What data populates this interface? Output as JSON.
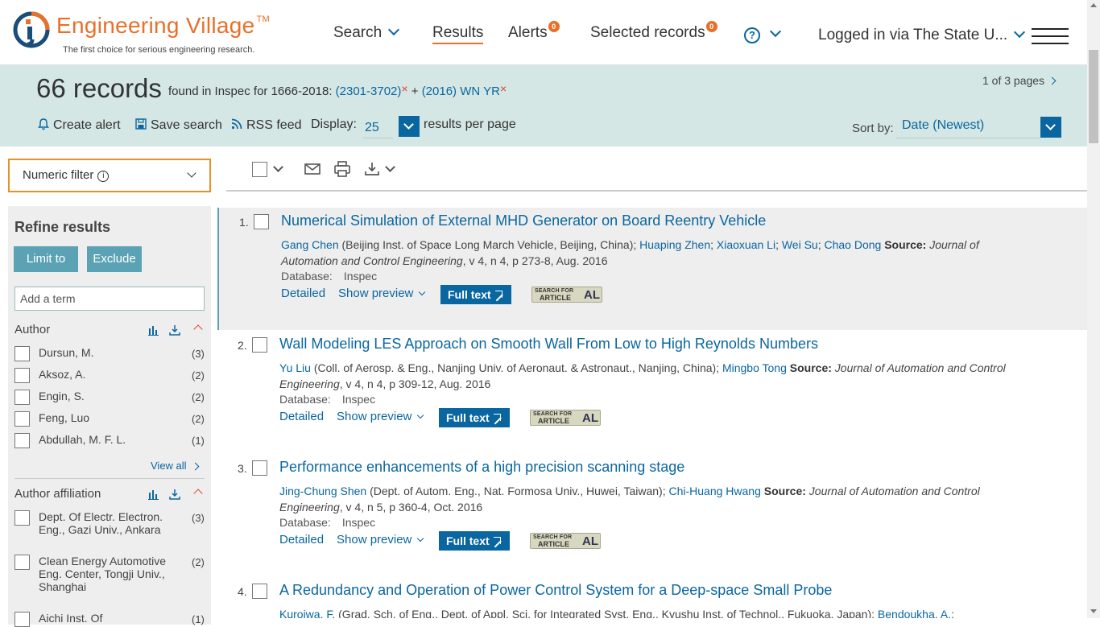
{
  "header": {
    "logo_text": "Engineering Village",
    "logo_tm": "TM",
    "tagline": "The first choice for serious engineering research.",
    "nav": {
      "search": "Search",
      "results": "Results",
      "alerts": "Alerts",
      "alerts_count": "0",
      "selected": "Selected records",
      "selected_count": "0",
      "help": "?",
      "login": "Logged in via The State U..."
    }
  },
  "summary": {
    "count": "66 records",
    "found_prefix": "found in Inspec for 1666-2018:",
    "term1": "(2301-3702)",
    "plus": "+",
    "term2": "(2016) WN YR",
    "remove": "×",
    "pages": "1 of 3 pages"
  },
  "toolbar": {
    "create_alert": "Create alert",
    "save_search": "Save search",
    "rss": "RSS feed",
    "display": "Display:",
    "display_value": "25",
    "per_page": "results per page",
    "sort_by": "Sort by:",
    "sort_value": "Date (Newest)"
  },
  "sidebar": {
    "numeric_filter": "Numeric filter",
    "refine_title": "Refine results",
    "limit": "Limit to",
    "exclude": "Exclude",
    "add_term_placeholder": "Add a term",
    "author_head": "Author",
    "authors": [
      {
        "name": "Dursun, M.",
        "count": "(3)"
      },
      {
        "name": "Aksoz, A.",
        "count": "(2)"
      },
      {
        "name": "Engin, S.",
        "count": "(2)"
      },
      {
        "name": "Feng, Luo",
        "count": "(2)"
      },
      {
        "name": "Abdullah, M. F. L.",
        "count": "(1)"
      }
    ],
    "view_all": "View all",
    "affil_head": "Author affiliation",
    "affiliations": [
      {
        "name": "Dept. Of Electr. Electron. Eng., Gazi Univ., Ankara",
        "count": "(3)"
      },
      {
        "name": "Clean Energy Automotive Eng. Center, Tongji Univ., Shanghai",
        "count": "(2)"
      },
      {
        "name": "Aichi Inst. Of",
        "count": "(1)"
      }
    ]
  },
  "results": [
    {
      "num": "1.",
      "title": "Numerical Simulation of External MHD Generator on Board Reentry Vehicle",
      "a1": "Gang Chen",
      "a1_affil": " (Beijing Inst. of Space Long March Vehicle, Beijing, China); ",
      "a2": "Huaping Zhen",
      "sep1": "; ",
      "a3": "Xiaoxuan Li",
      "sep2": "; ",
      "a4": "Wei Su",
      "sep3": "; ",
      "a5": "Chao Dong",
      "source_label": " Source: ",
      "journal": "Journal of Automation and Control Engineering",
      "citation": ", v 4, n 4, p 273-8, Aug. 2016"
    },
    {
      "num": "2.",
      "title": "Wall Modeling LES Approach on Smooth Wall From Low to High Reynolds Numbers",
      "a1": "Yu Liu",
      "a1_affil": " (Coll. of Aerosp. & Eng., Nanjing Univ. of Aeronaut. & Astronaut., Nanjing, China); ",
      "a2": "Mingbo Tong",
      "source_label": " Source: ",
      "journal": "Journal of Automation and Control Engineering",
      "citation": ", v 4, n 4, p 309-12, Aug. 2016"
    },
    {
      "num": "3.",
      "title": "Performance enhancements of a high precision scanning stage",
      "a1": "Jing-Chung Shen",
      "a1_affil": " (Dept. of Autom. Eng., Nat. Formosa Univ., Huwei, Taiwan); ",
      "a2": "Chi-Huang Hwang",
      "source_label": " Source: ",
      "journal": "Journal of Automation and Control Engineering",
      "citation": ", v 4, n 5, p 360-4, Oct. 2016"
    },
    {
      "num": "4.",
      "title": "A Redundancy and Operation of Power Control System for a Deep-space Small Probe",
      "a1": "Kuroiwa, F.",
      "a1_affil": " (Grad. Sch. of Eng., Dept. of Appl. Sci. for Integrated Syst. Eng., Kyushu Inst. of Technol., Fukuoka, Japan); ",
      "a2": "Bendoukha, A.",
      "sep1": ";"
    }
  ],
  "result_common": {
    "database_label": "Database:",
    "database_value": "Inspec",
    "detailed": "Detailed",
    "show_preview": "Show preview",
    "full_text": "Full text",
    "sfa_line1": "SEARCH FOR",
    "sfa_line2": "ARTICLE",
    "sfa_line3": "AL"
  },
  "colors": {
    "accent_orange": "#e8702a",
    "link_blue": "#0a66a0",
    "band_teal": "#d4e7e4",
    "button_teal": "#5ba3b4"
  }
}
